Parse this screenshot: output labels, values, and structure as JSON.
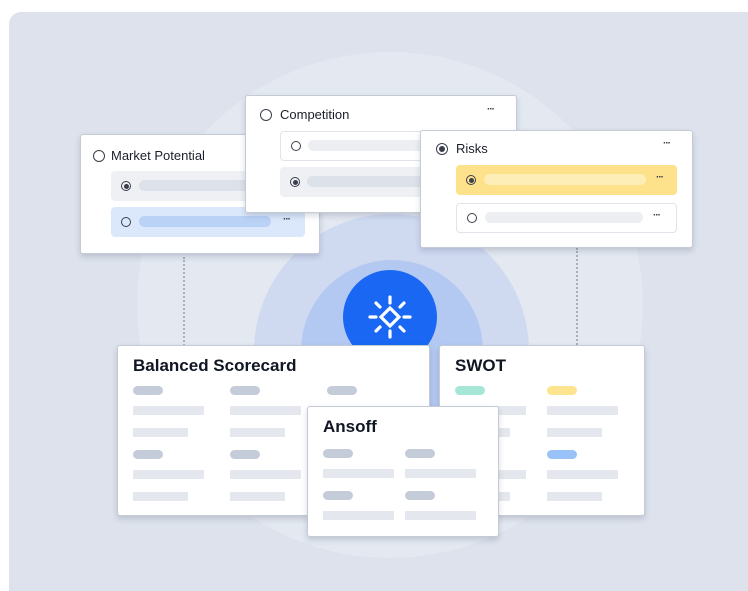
{
  "cards": {
    "market_potential": {
      "title": "Market Potential"
    },
    "competition": {
      "title": "Competition",
      "more": "···"
    },
    "risks": {
      "title": "Risks",
      "more": "···"
    }
  },
  "frameworks": {
    "balanced_scorecard": {
      "title": "Balanced Scorecard"
    },
    "swot": {
      "title": "SWOT"
    },
    "ansoff": {
      "title": "Ansoff"
    }
  },
  "row_more": "···",
  "colors": {
    "background": "#dde2ec",
    "hub": "#1967f2",
    "selected_row": "#fee28b",
    "highlight_row": "#dbe8fb",
    "swot_green": "#a6e6d7",
    "swot_yellow": "#fde48e",
    "swot_blue": "#99c2f9"
  },
  "icons": {
    "hub": "sparkle-diamond-icon",
    "radio": "radio-button-icon",
    "more": "more-dots-icon"
  }
}
